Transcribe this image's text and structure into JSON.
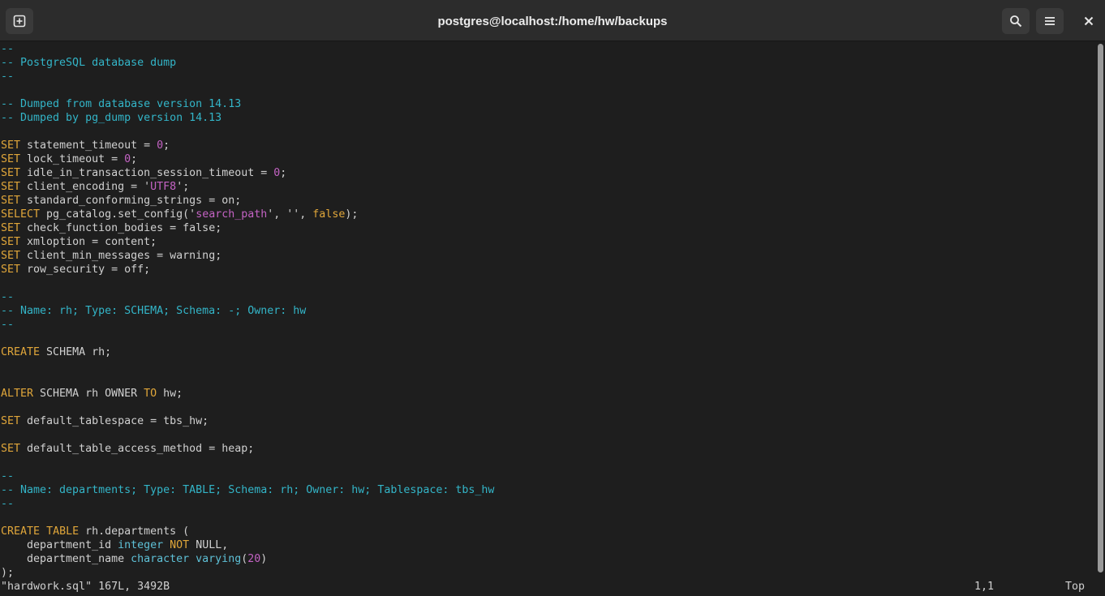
{
  "window": {
    "title": "postgres@localhost:/home/hw/backups",
    "buttons": {
      "new_tab_icon": "new-tab-icon",
      "search_icon": "search-icon",
      "menu_icon": "hamburger-menu-icon",
      "close_icon": "close-icon"
    }
  },
  "colors": {
    "background": "#1e1e1e",
    "comment": "#33b5c8",
    "keyword": "#e0a63a",
    "literal": "#c463c4",
    "type": "#5ec0d6",
    "text": "#d0d0d0"
  },
  "editor": {
    "lines": [
      [
        {
          "t": "--",
          "c": "comment"
        }
      ],
      [
        {
          "t": "-- PostgreSQL database dump",
          "c": "comment"
        }
      ],
      [
        {
          "t": "--",
          "c": "comment"
        }
      ],
      [],
      [
        {
          "t": "-- Dumped from database version 14.13",
          "c": "comment"
        }
      ],
      [
        {
          "t": "-- Dumped by pg_dump version 14.13",
          "c": "comment"
        }
      ],
      [],
      [
        {
          "t": "SET",
          "c": "kw"
        },
        {
          "t": " statement_timeout = ",
          "c": ""
        },
        {
          "t": "0",
          "c": "num"
        },
        {
          "t": ";",
          "c": ""
        }
      ],
      [
        {
          "t": "SET",
          "c": "kw"
        },
        {
          "t": " lock_timeout = ",
          "c": ""
        },
        {
          "t": "0",
          "c": "num"
        },
        {
          "t": ";",
          "c": ""
        }
      ],
      [
        {
          "t": "SET",
          "c": "kw"
        },
        {
          "t": " idle_in_transaction_session_timeout = ",
          "c": ""
        },
        {
          "t": "0",
          "c": "num"
        },
        {
          "t": ";",
          "c": ""
        }
      ],
      [
        {
          "t": "SET",
          "c": "kw"
        },
        {
          "t": " client_encoding = ",
          "c": ""
        },
        {
          "t": "'",
          "c": ""
        },
        {
          "t": "UTF8",
          "c": "str"
        },
        {
          "t": "';",
          "c": ""
        }
      ],
      [
        {
          "t": "SET",
          "c": "kw"
        },
        {
          "t": " standard_conforming_strings = on;",
          "c": ""
        }
      ],
      [
        {
          "t": "SELECT",
          "c": "kw"
        },
        {
          "t": " pg_catalog.set_config(",
          "c": ""
        },
        {
          "t": "'",
          "c": ""
        },
        {
          "t": "search_path",
          "c": "str"
        },
        {
          "t": "', '', ",
          "c": ""
        },
        {
          "t": "false",
          "c": "kw"
        },
        {
          "t": ");",
          "c": ""
        }
      ],
      [
        {
          "t": "SET",
          "c": "kw"
        },
        {
          "t": " check_function_bodies = false;",
          "c": ""
        }
      ],
      [
        {
          "t": "SET",
          "c": "kw"
        },
        {
          "t": " xmloption = content;",
          "c": ""
        }
      ],
      [
        {
          "t": "SET",
          "c": "kw"
        },
        {
          "t": " client_min_messages = warning;",
          "c": ""
        }
      ],
      [
        {
          "t": "SET",
          "c": "kw"
        },
        {
          "t": " row_security = off;",
          "c": ""
        }
      ],
      [],
      [
        {
          "t": "--",
          "c": "comment"
        }
      ],
      [
        {
          "t": "-- Name: rh; Type: SCHEMA; Schema: -; Owner: hw",
          "c": "comment"
        }
      ],
      [
        {
          "t": "--",
          "c": "comment"
        }
      ],
      [],
      [
        {
          "t": "CREATE",
          "c": "kw"
        },
        {
          "t": " SCHEMA rh;",
          "c": ""
        }
      ],
      [],
      [],
      [
        {
          "t": "ALTER",
          "c": "kw"
        },
        {
          "t": " SCHEMA rh OWNER ",
          "c": ""
        },
        {
          "t": "TO",
          "c": "kw"
        },
        {
          "t": " hw;",
          "c": ""
        }
      ],
      [],
      [
        {
          "t": "SET",
          "c": "kw"
        },
        {
          "t": " default_tablespace = tbs_hw;",
          "c": ""
        }
      ],
      [],
      [
        {
          "t": "SET",
          "c": "kw"
        },
        {
          "t": " default_table_access_method = heap;",
          "c": ""
        }
      ],
      [],
      [
        {
          "t": "--",
          "c": "comment"
        }
      ],
      [
        {
          "t": "-- Name: departments; Type: TABLE; Schema: rh; Owner: hw; Tablespace: tbs_hw",
          "c": "comment"
        }
      ],
      [
        {
          "t": "--",
          "c": "comment"
        }
      ],
      [],
      [
        {
          "t": "CREATE",
          "c": "kw"
        },
        {
          "t": " ",
          "c": ""
        },
        {
          "t": "TABLE",
          "c": "kw"
        },
        {
          "t": " rh.departments (",
          "c": ""
        }
      ],
      [
        {
          "t": "    department_id ",
          "c": ""
        },
        {
          "t": "integer",
          "c": "type"
        },
        {
          "t": " ",
          "c": ""
        },
        {
          "t": "NOT",
          "c": "kw"
        },
        {
          "t": " NULL,",
          "c": ""
        }
      ],
      [
        {
          "t": "    department_name ",
          "c": ""
        },
        {
          "t": "character varying",
          "c": "type"
        },
        {
          "t": "(",
          "c": ""
        },
        {
          "t": "20",
          "c": "num"
        },
        {
          "t": ")",
          "c": ""
        }
      ],
      [
        {
          "t": ");",
          "c": ""
        }
      ]
    ]
  },
  "statusline": {
    "file_info": "\"hardwork.sql\" 167L, 3492B",
    "cursor_position": "1,1",
    "scroll_position": "Top"
  }
}
